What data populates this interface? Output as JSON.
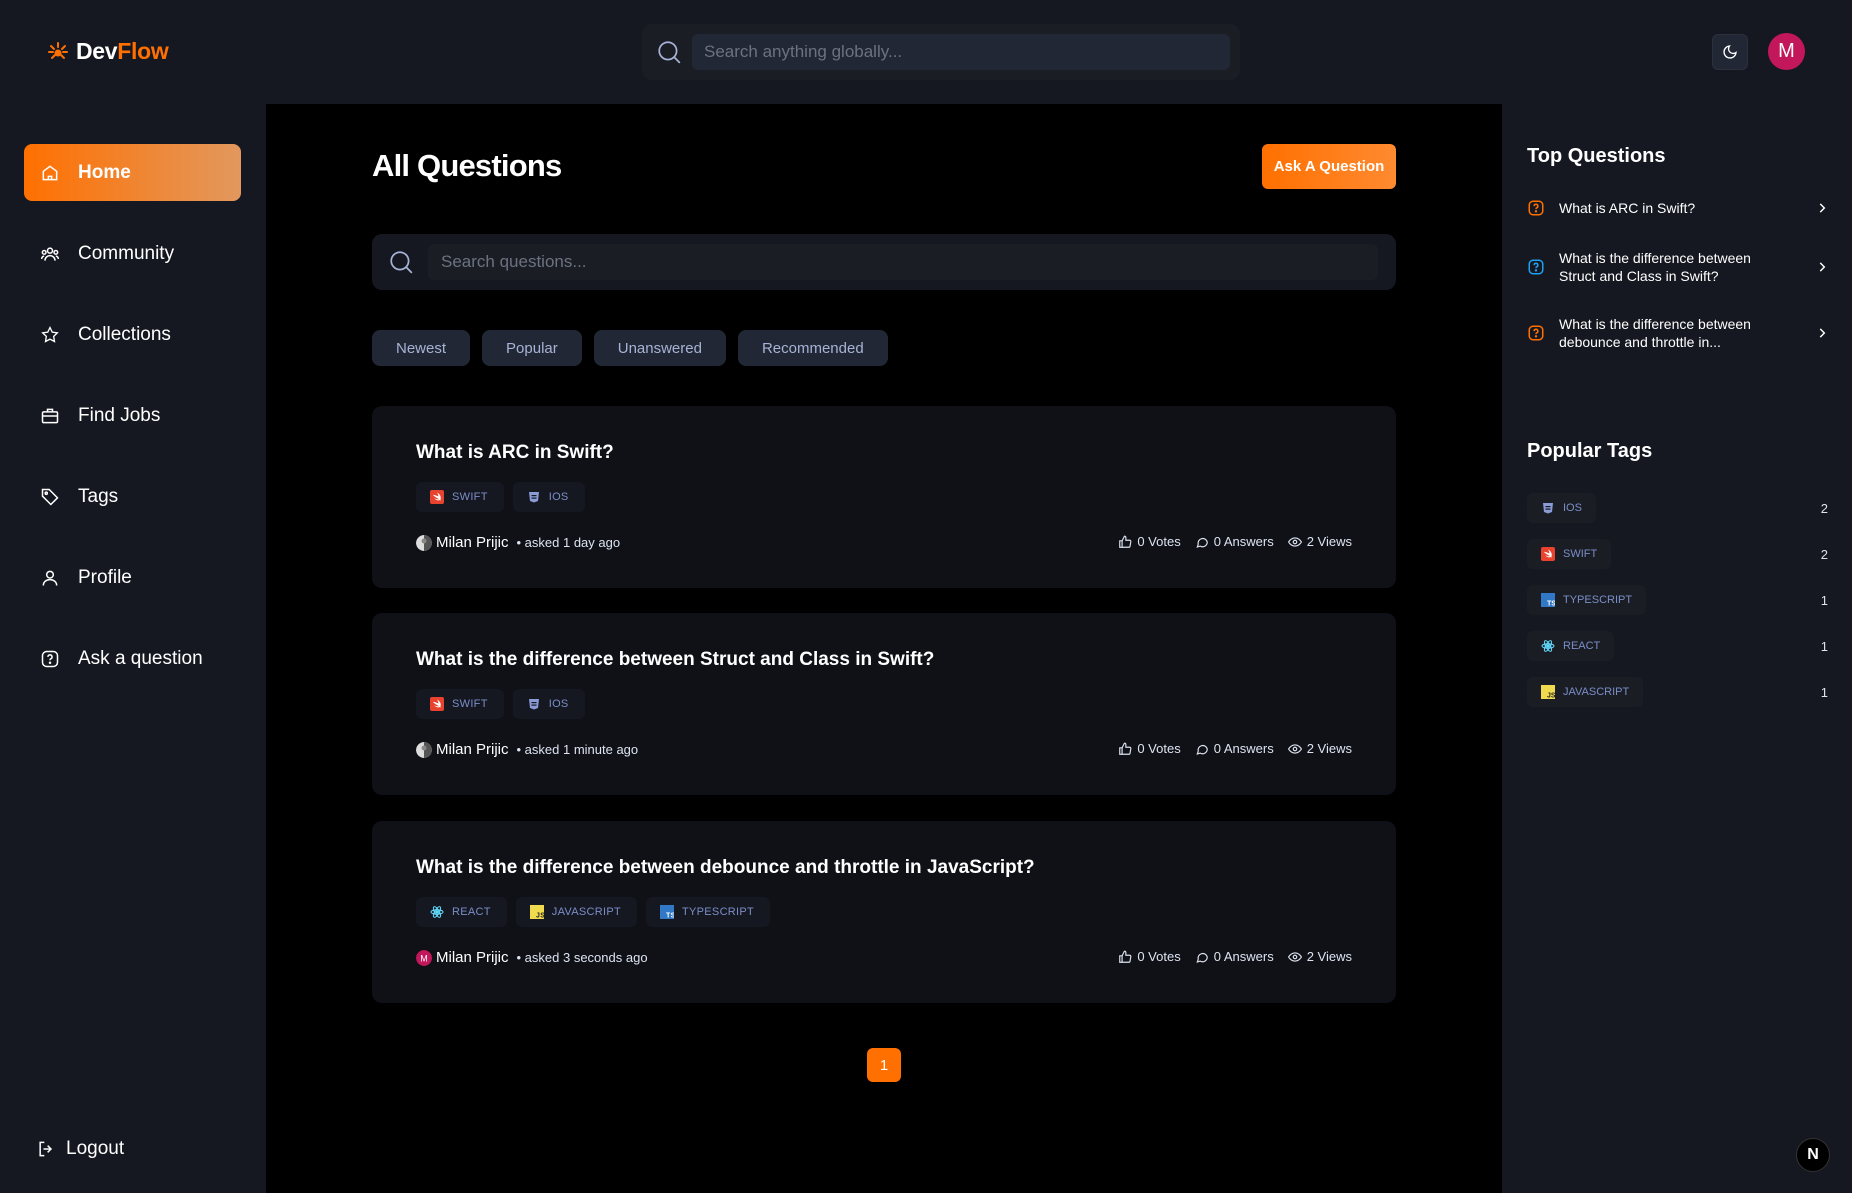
{
  "app": {
    "logo_dev": "Dev",
    "logo_flow": "Flow",
    "global_search_placeholder": "Search anything globally...",
    "avatar_initial": "M"
  },
  "sidebar": {
    "items": [
      {
        "label": "Home",
        "icon": "home-icon",
        "active": true
      },
      {
        "label": "Community",
        "icon": "users-icon",
        "active": false
      },
      {
        "label": "Collections",
        "icon": "star-icon",
        "active": false
      },
      {
        "label": "Find Jobs",
        "icon": "briefcase-icon",
        "active": false
      },
      {
        "label": "Tags",
        "icon": "tag-icon",
        "active": false
      },
      {
        "label": "Profile",
        "icon": "user-icon",
        "active": false
      },
      {
        "label": "Ask a question",
        "icon": "question-icon",
        "active": false
      }
    ],
    "logout_label": "Logout"
  },
  "main": {
    "title": "All Questions",
    "ask_button": "Ask A Question",
    "search_placeholder": "Search questions...",
    "filters": [
      "Newest",
      "Popular",
      "Unanswered",
      "Recommended"
    ],
    "questions": [
      {
        "title": "What is ARC in Swift?",
        "tags": [
          {
            "name": "SWIFT",
            "icon": "swift-icon"
          },
          {
            "name": "IOS",
            "icon": "ios-icon"
          }
        ],
        "author": "Milan Prijic",
        "asked": "• asked 1 day ago",
        "votes": "0 Votes",
        "answers": "0 Answers",
        "views": "2 Views"
      },
      {
        "title": "What is the difference between Struct and Class in Swift?",
        "tags": [
          {
            "name": "SWIFT",
            "icon": "swift-icon"
          },
          {
            "name": "IOS",
            "icon": "ios-icon"
          }
        ],
        "author": "Milan Prijic",
        "asked": "• asked 1 minute ago",
        "votes": "0 Votes",
        "answers": "0 Answers",
        "views": "2 Views"
      },
      {
        "title": "What is the difference between debounce and throttle in JavaScript?",
        "tags": [
          {
            "name": "REACT",
            "icon": "react-icon"
          },
          {
            "name": "JAVASCRIPT",
            "icon": "javascript-icon"
          },
          {
            "name": "TYPESCRIPT",
            "icon": "typescript-icon"
          }
        ],
        "author": "Milan Prijic",
        "asked": "• asked 3 seconds ago",
        "votes": "0 Votes",
        "answers": "0 Answers",
        "views": "2 Views"
      }
    ],
    "current_page": "1"
  },
  "right": {
    "top_questions_title": "Top Questions",
    "top_questions": [
      {
        "line1": "What is ARC in Swift?",
        "line2": "",
        "color": "#ff7000"
      },
      {
        "line1": "What is the difference between",
        "line2": "Struct and Class in Swift?",
        "color": "#1da1f2"
      },
      {
        "line1": "What is the difference between",
        "line2": "debounce and throttle in...",
        "color": "#ff7000"
      }
    ],
    "popular_tags_title": "Popular Tags",
    "popular_tags": [
      {
        "name": "IOS",
        "count": "2",
        "icon": "ios-icon"
      },
      {
        "name": "SWIFT",
        "count": "2",
        "icon": "swift-icon"
      },
      {
        "name": "TYPESCRIPT",
        "count": "1",
        "icon": "typescript-icon"
      },
      {
        "name": "REACT",
        "count": "1",
        "icon": "react-icon"
      },
      {
        "name": "JAVASCRIPT",
        "count": "1",
        "icon": "javascript-icon"
      }
    ]
  },
  "colors": {
    "accent": "#ff7000",
    "background": "#000000",
    "panel": "#151821",
    "card": "#0f1117",
    "tag_text": "#7b8ec8"
  },
  "next_badge": "N"
}
